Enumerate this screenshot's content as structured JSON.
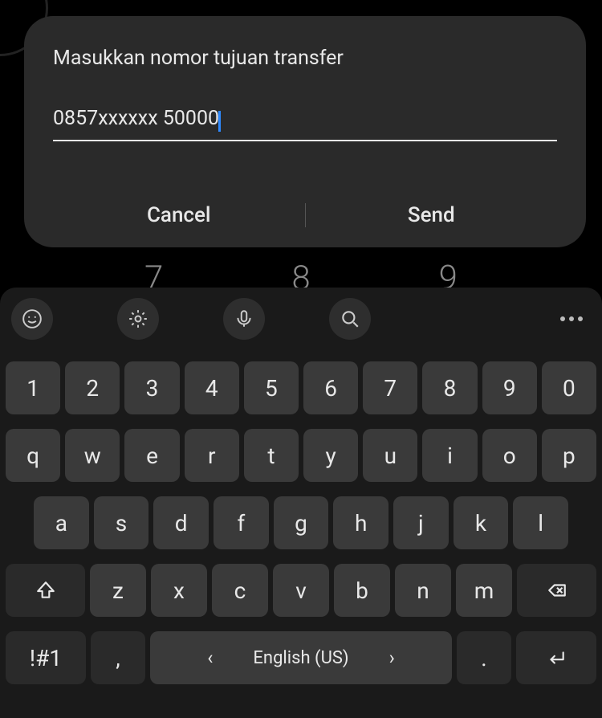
{
  "dialog": {
    "title": "Masukkan nomor tujuan transfer",
    "input_value": "0857xxxxxx 50000",
    "cancel_label": "Cancel",
    "send_label": "Send"
  },
  "dialpad_hint": {
    "d1": "7",
    "d2": "8",
    "d3": "9"
  },
  "keyboard": {
    "row_num": [
      "1",
      "2",
      "3",
      "4",
      "5",
      "6",
      "7",
      "8",
      "9",
      "0"
    ],
    "row_q": [
      "q",
      "w",
      "e",
      "r",
      "t",
      "y",
      "u",
      "i",
      "o",
      "p"
    ],
    "row_a": [
      "a",
      "s",
      "d",
      "f",
      "g",
      "h",
      "j",
      "k",
      "l"
    ],
    "row_z": [
      "z",
      "x",
      "c",
      "v",
      "b",
      "n",
      "m"
    ],
    "sym_label": "!#1",
    "comma_label": ",",
    "space_label": "English (US)",
    "dot_label": "."
  }
}
